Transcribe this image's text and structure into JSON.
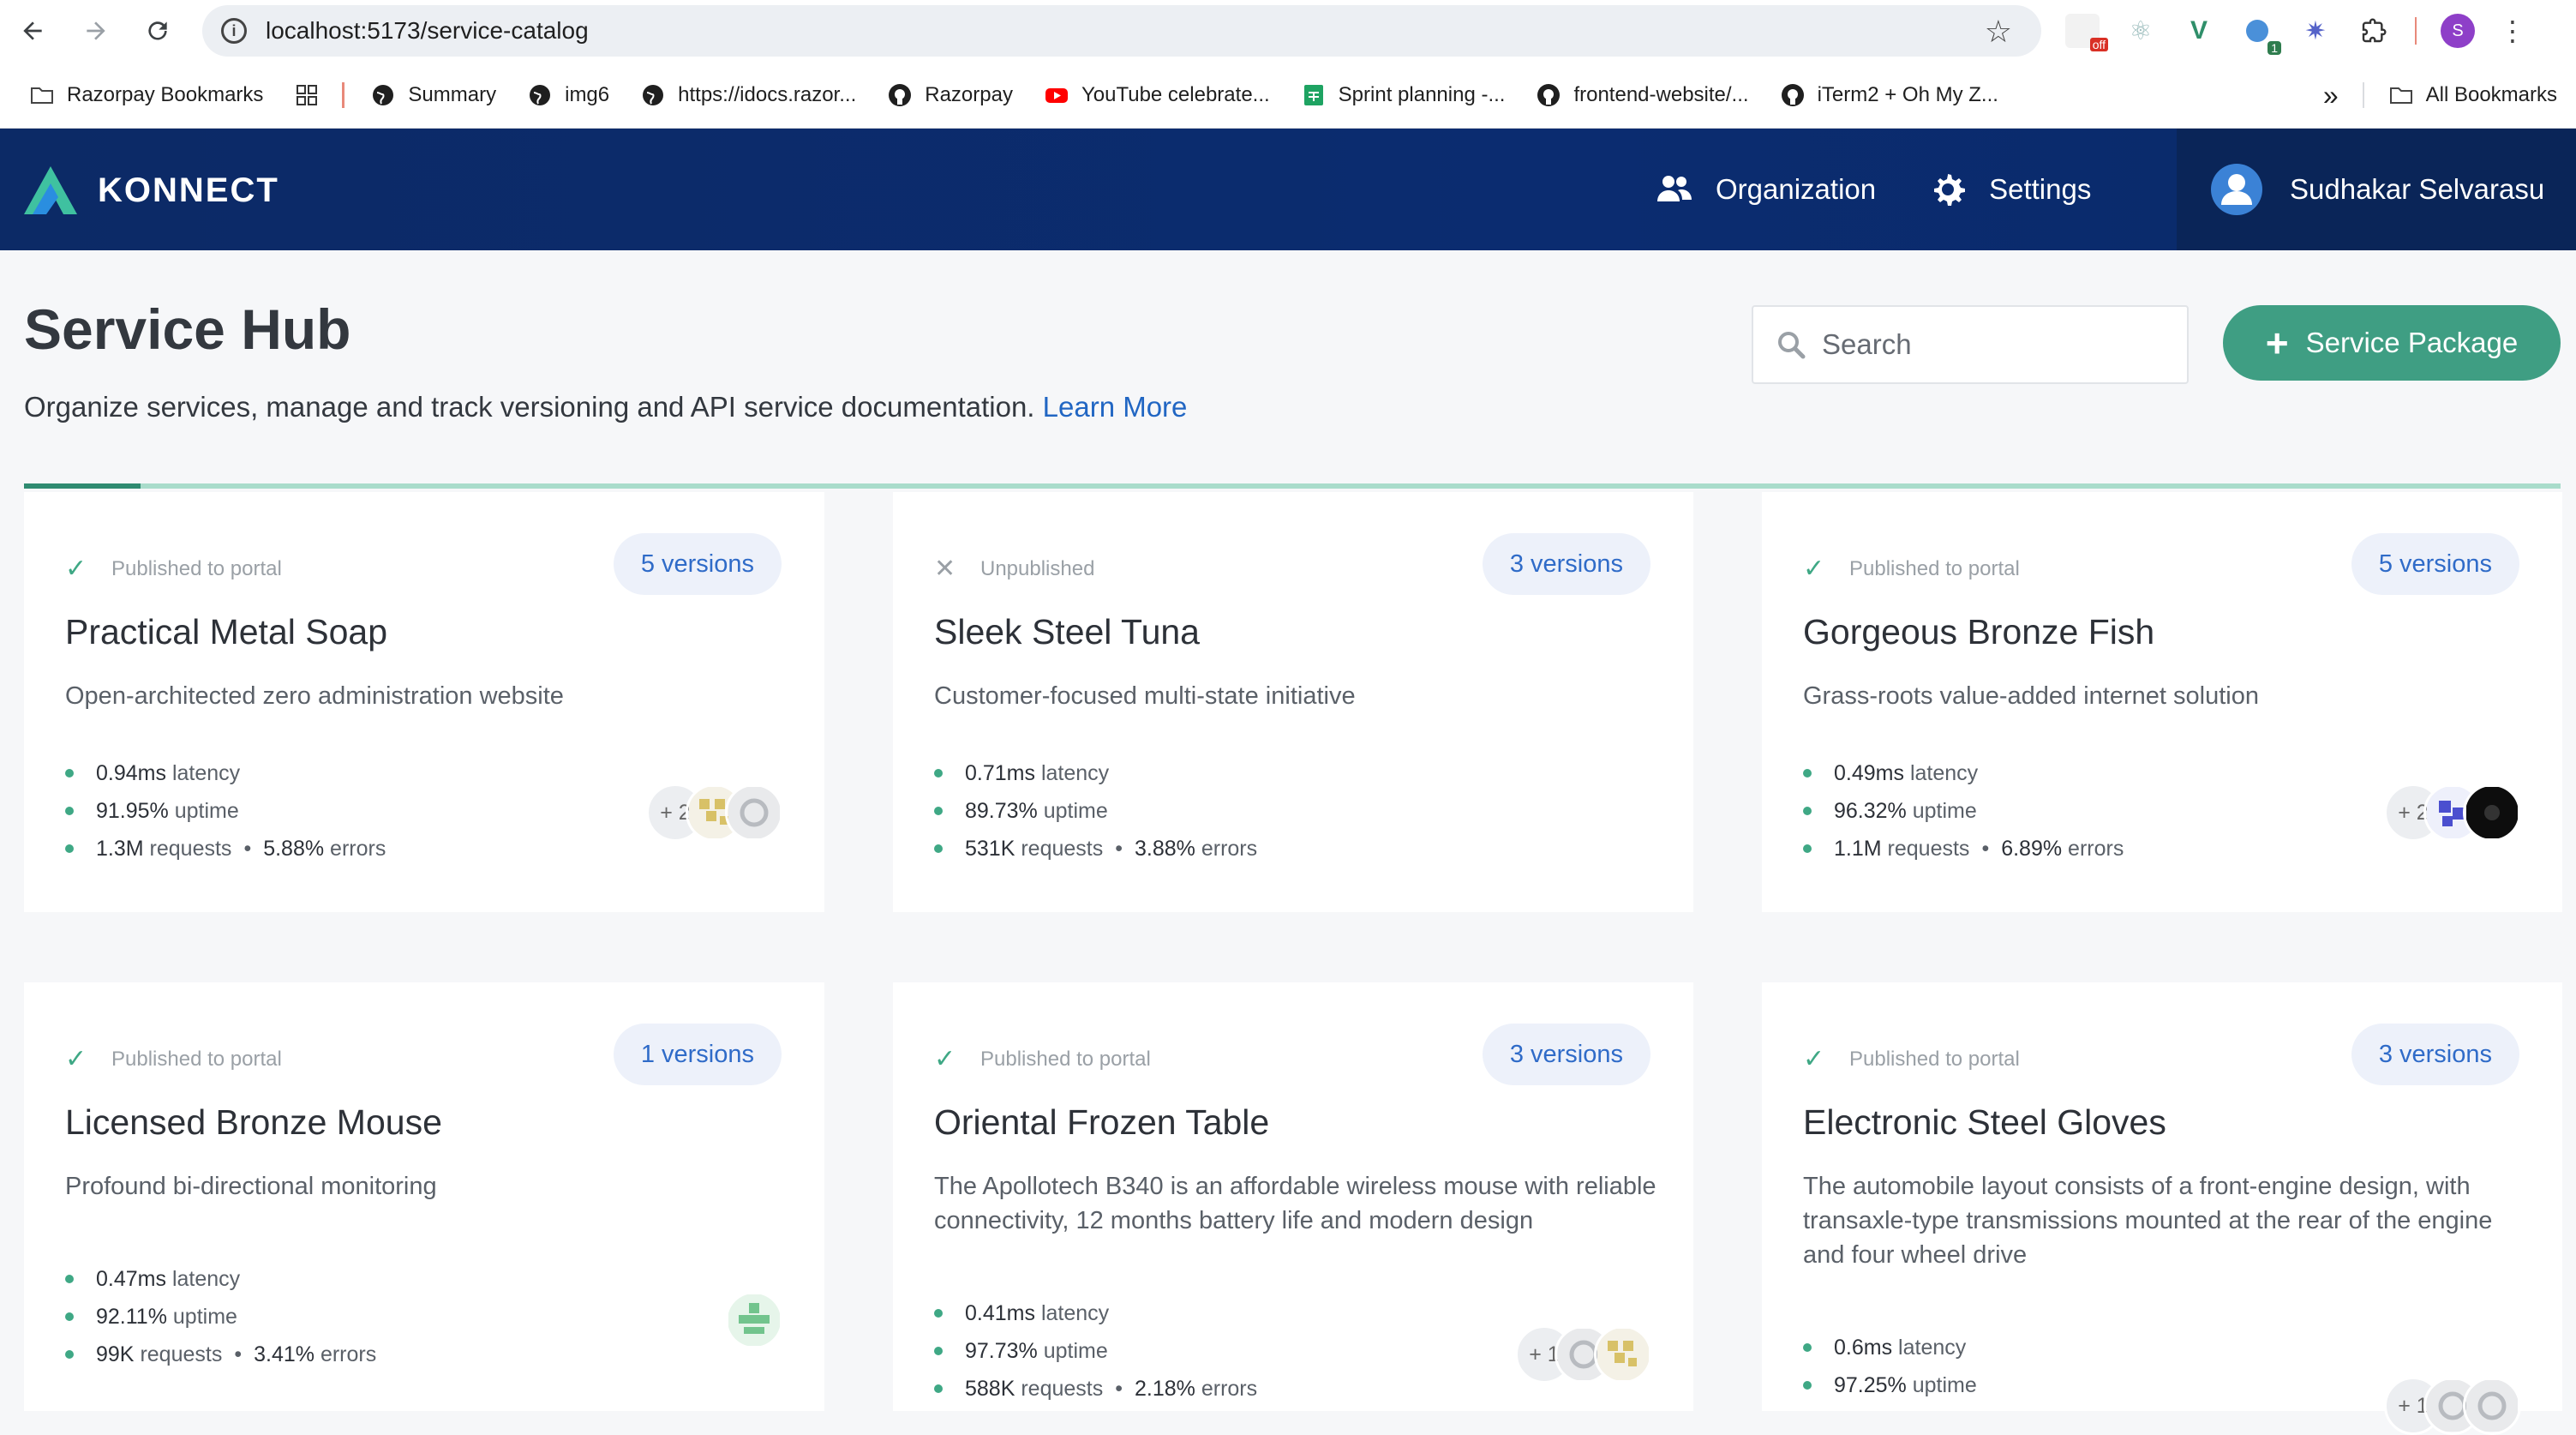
{
  "browser": {
    "url": "localhost:5173/service-catalog",
    "bookmarks": [
      {
        "label": "Razorpay Bookmarks",
        "icon": "folder-icon"
      },
      {
        "label": "Summary",
        "icon": "globe-icon"
      },
      {
        "label": "img6",
        "icon": "globe-icon"
      },
      {
        "label": "https://idocs.razor...",
        "icon": "globe-icon"
      },
      {
        "label": "Razorpay",
        "icon": "github-icon"
      },
      {
        "label": "YouTube celebrate...",
        "icon": "youtube-icon"
      },
      {
        "label": "Sprint planning -...",
        "icon": "sheets-icon"
      },
      {
        "label": "frontend-website/...",
        "icon": "github-icon"
      },
      {
        "label": "iTerm2 + Oh My Z...",
        "icon": "github-icon"
      }
    ],
    "overflow_label": "»",
    "all_bookmarks_label": "All Bookmarks",
    "profile_initial": "S",
    "ext_badges": {
      "off": "off",
      "count": "1"
    }
  },
  "header": {
    "brand": "KONNECT",
    "nav": [
      {
        "label": "Organization",
        "icon": "people-icon"
      },
      {
        "label": "Settings",
        "icon": "gear-icon"
      }
    ],
    "user_name": "Sudhakar Selvarasu"
  },
  "page": {
    "title": "Service Hub",
    "subtitle": "Organize services, manage and track versioning and API service documentation.",
    "learn_more": "Learn More",
    "search_placeholder": "Search",
    "primary_button": "Service Package",
    "scroll_progress": 0.046
  },
  "cards": [
    {
      "status": "Published to portal",
      "published": true,
      "versions": "5 versions",
      "title": "Practical Metal Soap",
      "description": "Open-architected zero administration website",
      "latency": "0.94ms",
      "latency_label": "latency",
      "uptime": "91.95%",
      "uptime_label": "uptime",
      "requests": "1.3M",
      "requests_label": "requests",
      "errors": "5.88%",
      "errors_label": "errors",
      "extra_count": "+ 2"
    },
    {
      "status": "Unpublished",
      "published": false,
      "versions": "3 versions",
      "title": "Sleek Steel Tuna",
      "description": "Customer-focused multi-state initiative",
      "latency": "0.71ms",
      "latency_label": "latency",
      "uptime": "89.73%",
      "uptime_label": "uptime",
      "requests": "531K",
      "requests_label": "requests",
      "errors": "3.88%",
      "errors_label": "errors",
      "extra_count": ""
    },
    {
      "status": "Published to portal",
      "published": true,
      "versions": "5 versions",
      "title": "Gorgeous Bronze Fish",
      "description": "Grass-roots value-added internet solution",
      "latency": "0.49ms",
      "latency_label": "latency",
      "uptime": "96.32%",
      "uptime_label": "uptime",
      "requests": "1.1M",
      "requests_label": "requests",
      "errors": "6.89%",
      "errors_label": "errors",
      "extra_count": "+ 2"
    },
    {
      "status": "Published to portal",
      "published": true,
      "versions": "1 versions",
      "title": "Licensed Bronze Mouse",
      "description": "Profound bi-directional monitoring",
      "latency": "0.47ms",
      "latency_label": "latency",
      "uptime": "92.11%",
      "uptime_label": "uptime",
      "requests": "99K",
      "requests_label": "requests",
      "errors": "3.41%",
      "errors_label": "errors",
      "extra_count": ""
    },
    {
      "status": "Published to portal",
      "published": true,
      "versions": "3 versions",
      "title": "Oriental Frozen Table",
      "description": "The Apollotech B340 is an affordable wireless mouse with reliable connectivity, 12 months battery life and modern design",
      "latency": "0.41ms",
      "latency_label": "latency",
      "uptime": "97.73%",
      "uptime_label": "uptime",
      "requests": "588K",
      "requests_label": "requests",
      "errors": "2.18%",
      "errors_label": "errors",
      "extra_count": "+ 1"
    },
    {
      "status": "Published to portal",
      "published": true,
      "versions": "3 versions",
      "title": "Electronic Steel Gloves",
      "description": "The automobile layout consists of a front-engine design, with transaxle-type transmissions mounted at the rear of the engine and four wheel drive",
      "latency": "0.6ms",
      "latency_label": "latency",
      "uptime": "97.25%",
      "uptime_label": "uptime",
      "requests": "",
      "requests_label": "",
      "errors": "",
      "errors_label": "",
      "extra_count": "+ 1"
    }
  ],
  "colors": {
    "header_bg": "#0c2a66",
    "accent_green": "#3f9e83",
    "link_blue": "#2166c3",
    "metric_dot": "#3fa885"
  }
}
